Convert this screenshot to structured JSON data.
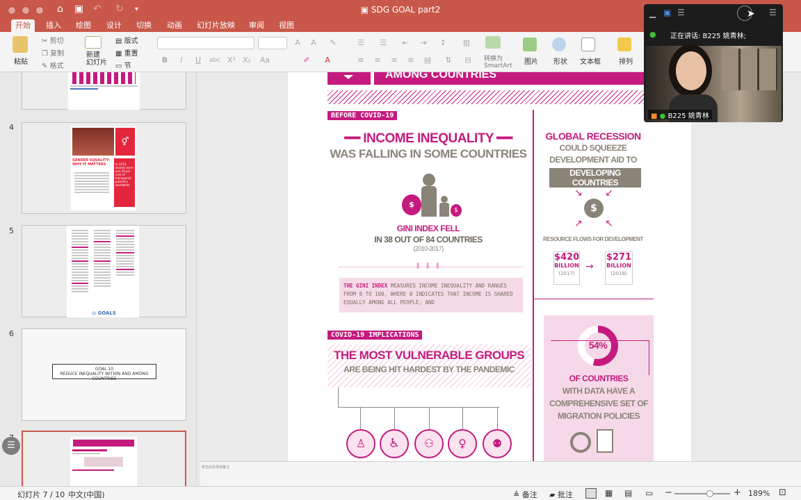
{
  "window": {
    "title": "SDG GOAL part2"
  },
  "tabs": [
    {
      "label": "开始",
      "active": true
    },
    {
      "label": "插入"
    },
    {
      "label": "绘图"
    },
    {
      "label": "设计"
    },
    {
      "label": "切换"
    },
    {
      "label": "动画"
    },
    {
      "label": "幻灯片放映"
    },
    {
      "label": "审阅"
    },
    {
      "label": "视图"
    }
  ],
  "ribbon": {
    "paste": "粘贴",
    "cut": "剪切",
    "copy": "复制",
    "format": "格式",
    "new_slide": "新建\n幻灯片",
    "layout": "版式",
    "reset": "重置",
    "section": "节",
    "convert_smartart": "转换为\nSmartArt",
    "picture": "图片",
    "shape": "形状",
    "textbox": "文本框",
    "arrange": "排列"
  },
  "slides": [
    {
      "number": "4"
    },
    {
      "number": "5"
    },
    {
      "number": "6",
      "text": "GOAL 10\nREDUCE INEQUALITY WITHIN AND AMONG COUNTRIES"
    },
    {
      "number": "7"
    }
  ],
  "thumb4": {
    "title": "GENDER EQUALITY: WHY IT MATTERS",
    "stat": "In 2019, women were just 28 per cent of managerial positions worldwide"
  },
  "slide": {
    "banner": "AMONG COUNTRIES",
    "before_label": "BEFORE COVID-19",
    "income_title": "INCOME INEQUALITY",
    "income_sub": "WAS FALLING IN SOME COUNTRIES",
    "gini1": "GINI INDEX FELL",
    "gini2": "IN 38 OUT OF 84 COUNTRIES",
    "gini3": "(2010-2017)",
    "gini_def_bold": "THE GINI INDEX",
    "gini_def": "MEASURES INCOME INEQUALITY AND RANGES FROM 0 TO 100, WHERE 0 INDICATES THAT INCOME IS SHARED EQUALLY AMONG ALL PEOPLE, AND",
    "recession1": "GLOBAL RECESSION",
    "recession2": "COULD SQUEEZE",
    "recession3": "DEVELOPMENT AID TO",
    "recession4": "DEVELOPING COUNTRIES",
    "flows": "RESOURCE FLOWS FOR DEVELOPMENT",
    "flow1_value": "$420",
    "flow1_unit": "BILLION",
    "flow1_year": "(2017)",
    "flow2_value": "$271",
    "flow2_unit": "BILLION",
    "flow2_year": "(2018)",
    "covid_label": "COVID-19 IMPLICATIONS",
    "vuln1": "THE MOST VULNERABLE GROUPS",
    "vuln2": "ARE BEING HIT HARDEST BY THE PANDEMIC",
    "pct": "54%",
    "pct_value": 54,
    "countries1": "OF COUNTRIES",
    "countries2": "WITH DATA HAVE A",
    "countries3": "COMPREHENSIVE SET OF",
    "countries4": "MIGRATION POLICIES",
    "groups": [
      "OLDER PERSONS",
      "PERSONS WITH",
      "CHILDREN",
      "WOMEN",
      "MIGRANTS AND"
    ]
  },
  "notes": {
    "placeholder": "单击此处添加备注"
  },
  "status": {
    "slide_counter": "幻灯片 7 / 10",
    "language": "中文(中国)",
    "notes_btn": "备注",
    "comments_btn": "批注",
    "zoom": "189%"
  },
  "video": {
    "speaking": "正在讲话: B225 姚青林;",
    "name": "B225 姚青林"
  },
  "colors": {
    "accent": "#c51a7e",
    "titlebar": "#c9584a",
    "text_gray": "#8a8378"
  }
}
